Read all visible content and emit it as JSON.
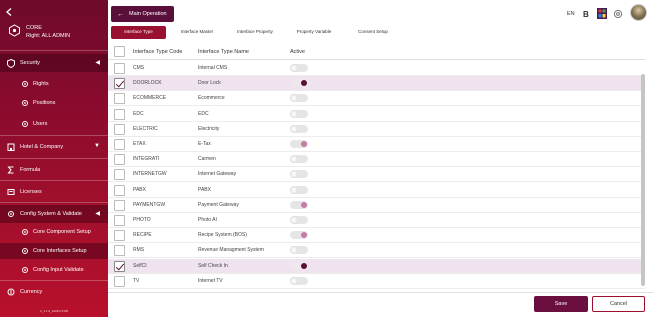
{
  "sidebar": {
    "back_icon": "back-arrow-icon",
    "app_name": "CORE",
    "role": "Right: ALL ADMIN",
    "menu": {
      "security": "Security",
      "rights": "Rights",
      "positions": "Positions",
      "users": "Users",
      "hotel_company": "Hotel & Company",
      "formula": "Formula",
      "licenses": "Licenses",
      "config_system": "Config System & Validate",
      "core_component_setup": "Core Component Setup",
      "core_interfaces_setup": "Core Interfaces Setup",
      "config_input_validate": "Config Input Validate",
      "currency": "Currency"
    },
    "version": "V_1.1.0_2403171106"
  },
  "topbar": {
    "main_operation": "Main Operation",
    "language": "EN",
    "bold": "B"
  },
  "tabs": [
    {
      "label": "Interface Type",
      "active": true
    },
    {
      "label": "Interface Master",
      "active": false
    },
    {
      "label": "Interface Property",
      "active": false
    },
    {
      "label": "Property Variable",
      "active": false
    },
    {
      "label": "Consent Setup",
      "active": false
    }
  ],
  "table": {
    "columns": [
      "Interface Type Code",
      "Interface Type Name",
      "Active"
    ],
    "rows": [
      {
        "code": "CMS",
        "name": "Internal CMS",
        "checked": false,
        "active": "off"
      },
      {
        "code": "DOORLOCK",
        "name": "Door Lock",
        "checked": true,
        "active": "on-dark"
      },
      {
        "code": "ECOMMERCE",
        "name": "Ecommerce",
        "checked": false,
        "active": "off"
      },
      {
        "code": "EDC",
        "name": "EDC",
        "checked": false,
        "active": "off"
      },
      {
        "code": "ELECTRIC",
        "name": "Electricity",
        "checked": false,
        "active": "off"
      },
      {
        "code": "ETAX",
        "name": "E-Tax",
        "checked": false,
        "active": "on-pink"
      },
      {
        "code": "INTEGRATI",
        "name": "Carmen",
        "checked": false,
        "active": "off"
      },
      {
        "code": "INTERNETGW",
        "name": "Internet Gateway",
        "checked": false,
        "active": "off"
      },
      {
        "code": "PABX",
        "name": "PABX",
        "checked": false,
        "active": "off"
      },
      {
        "code": "PAYMENTGW",
        "name": "Payment Gateway",
        "checked": false,
        "active": "on-pink"
      },
      {
        "code": "PHOTO",
        "name": "Photo AI",
        "checked": false,
        "active": "off"
      },
      {
        "code": "RECIPE",
        "name": "Recipe System (BOS)",
        "checked": false,
        "active": "on-pink"
      },
      {
        "code": "RMS",
        "name": "Revenue Managment System",
        "checked": false,
        "active": "off"
      },
      {
        "code": "SelfCI",
        "name": "Self Check In",
        "checked": true,
        "active": "on-dark"
      },
      {
        "code": "TV",
        "name": "Internet TV",
        "checked": false,
        "active": "off"
      }
    ]
  },
  "footer": {
    "save_label": "Save",
    "cancel_label": "Cancel"
  },
  "colors": {
    "brand": "#9a1030",
    "brand_dark": "#5a0f3a",
    "selected_row": "#efe3ef",
    "toggle_pink": "#c77aa6"
  }
}
